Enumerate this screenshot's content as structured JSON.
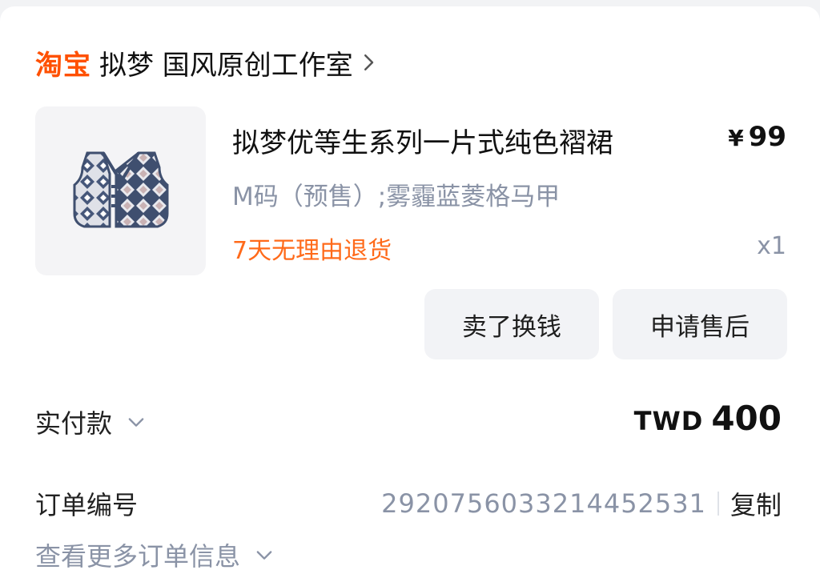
{
  "store": {
    "platform_logo": "淘宝",
    "name": "拟梦 国风原创工作室"
  },
  "item": {
    "title": "拟梦优等生系列一片式纯色褶裙",
    "currency_symbol": "¥",
    "price": "99",
    "sku": "M码（预售）;雾霾蓝菱格马甲",
    "policy": "7天无理由退货",
    "quantity": "x1",
    "image_icon": "argyle-vest-icon"
  },
  "actions": {
    "resell_label": "卖了换钱",
    "aftersale_label": "申请售后"
  },
  "payment": {
    "label": "实付款",
    "currency": "TWD",
    "amount": "400"
  },
  "order": {
    "label": "订单编号",
    "number": "2920756033214452531",
    "copy_label": "复制",
    "more_label": "查看更多订单信息"
  },
  "colors": {
    "brand_orange": "#ff5000",
    "policy_orange": "#ff6a1a",
    "muted_text": "#8a93a6",
    "button_bg": "#f2f3f6",
    "vest_navy": "#3f4f6f",
    "vest_light": "#e8e9ee",
    "vest_pink": "#c9b2b4"
  }
}
